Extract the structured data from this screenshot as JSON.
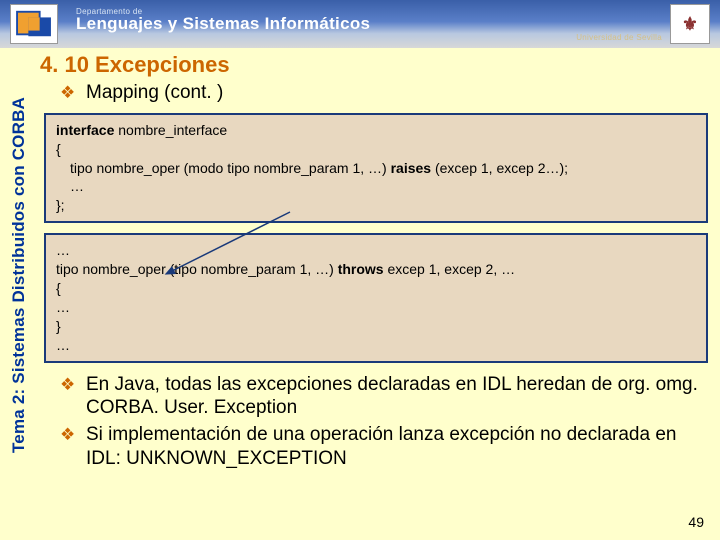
{
  "header": {
    "dept": "Departamento de",
    "main": "Lenguajes y Sistemas Informáticos",
    "univ": "Universidad de Sevilla",
    "right_logo_text": "⚜"
  },
  "sidebar": {
    "text": "Tema 2: Sistemas Distribuidos con CORBA"
  },
  "section": {
    "title": "4. 10 Excepciones"
  },
  "bullets": {
    "b1": "Mapping (cont. )",
    "b2": "En Java, todas las excepciones declaradas en IDL heredan de org. omg. CORBA. User. Exception",
    "b3": "Si implementación de una operación lanza excepción no declarada en IDL: UNKNOWN_EXCEPTION"
  },
  "code1": {
    "l1a": "interface",
    "l1b": " nombre_interface",
    "l2": "{",
    "l3a": "tipo nombre_oper (modo tipo nombre_param 1, …) ",
    "l3b": "raises",
    "l3c": " (excep 1, excep 2…);",
    "l4": "…",
    "l5": "};"
  },
  "code2": {
    "l1": "…",
    "l2a": "tipo nombre_oper (tipo nombre_param 1, …) ",
    "l2b": "throws",
    "l2c": " excep 1, excep 2, …",
    "l3": " {",
    "l4": "  …",
    "l5": " }",
    "l6": "…"
  },
  "page_number": "49"
}
